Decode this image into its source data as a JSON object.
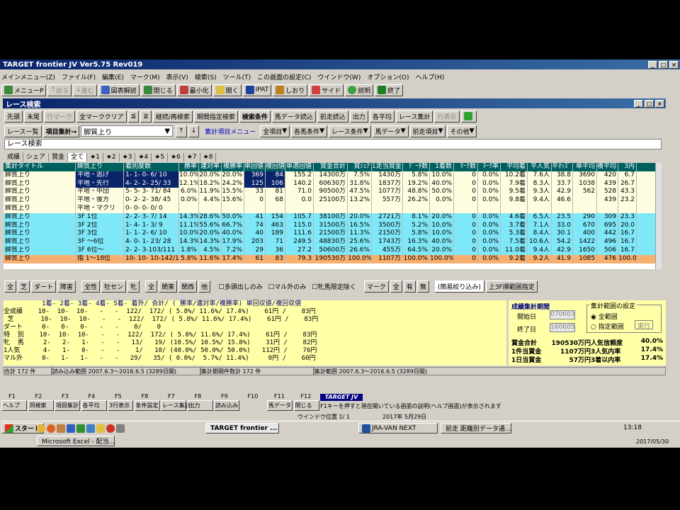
{
  "app": {
    "title": "TARGET frontier JV  Ver5.75  Rev019"
  },
  "menu": [
    "メインメニュー(Z)",
    "ファイル(F)",
    "編集(E)",
    "マーク(M)",
    "表示(V)",
    "検索(S)",
    "ツール(T)",
    "この画面の設定(C)",
    "ウインドウ(W)",
    "オプション(O)",
    "ヘルプ(H)"
  ],
  "toolbar": [
    "メニューP",
    "戻る",
    "進む",
    "図表解説",
    "閉じる",
    "最小化",
    "開く",
    "IPAT",
    "しおり",
    "サイド",
    "説明",
    "終了"
  ],
  "subwindow": {
    "title": "レース検索"
  },
  "buttons1": [
    "先頭",
    "末尾",
    "行マーク",
    "全マーククリア",
    "≦",
    "≧",
    "継続/再検索",
    "期間指定検索",
    "検索条件",
    "馬データ読込",
    "前走読込",
    "出力",
    "各平均",
    "レース集計",
    "行表示"
  ],
  "selector": {
    "label1": "レース一覧",
    "label2": "項目集計→",
    "value": "脚質上り",
    "menu": "集計項目メニュー",
    "dropdowns": [
      "全項目",
      "各馬条件",
      "レース条件",
      "馬データ",
      "前走項目",
      "その他"
    ]
  },
  "search_label": "レース検索",
  "tabs": [
    "成績",
    "シェア",
    "賞金",
    "全て",
    "★1",
    "★2",
    "★3",
    "★4",
    "★5",
    "★6",
    "★7",
    "★8"
  ],
  "grid": {
    "headers": [
      "集計タイトル",
      "脚質上り",
      "着別度数",
      "勝率",
      "連対率",
      "複勝率",
      "単回値",
      "複回値",
      "単適回値",
      "賞金合計",
      "賞ｼｪｱ",
      "1走当賞金",
      "ﾃﾞｰﾀ数",
      "1着数",
      "ﾏｰｸ数",
      "ﾏｰｸ率",
      "平均着",
      "平人気",
      "平ｵｯｽﾞ",
      "単平均",
      "複平均",
      "3内"
    ],
    "rows": [
      [
        "脚質上り",
        "平地・逃げ",
        "1- 1- 0- 6/ 10",
        "10.0%",
        "20.0%",
        "20.0%",
        "369",
        "84",
        "155.2",
        "14300万",
        "7.5%",
        "1430万",
        "5.8%",
        "10.0%",
        "0",
        "0.0%",
        "10.2着",
        "7.6人",
        "38.8",
        "3690",
        "420",
        "6.7"
      ],
      [
        "脚質上り",
        "平地・先行",
        "4- 2- 2- 25/ 33",
        "12.1%",
        "18.2%",
        "24.2%",
        "125",
        "106",
        "140.2",
        "60630万",
        "31.8%",
        "1837万",
        "19.2%",
        "40.0%",
        "0",
        "0.0%",
        "7.9着",
        "8.3人",
        "33.7",
        "1038",
        "439",
        "26.7"
      ],
      [
        "脚質上り",
        "平地・中団",
        "5- 5- 3- 71/ 84",
        "6.0%",
        "11.9%",
        "15.5%",
        "33",
        "81",
        "71.0",
        "90500万",
        "47.5%",
        "1077万",
        "48.8%",
        "50.0%",
        "0",
        "0.0%",
        "9.5着",
        "9.3人",
        "42.9",
        "562",
        "528",
        "43.3"
      ],
      [
        "脚質上り",
        "平地・後方",
        "0- 2- 2- 38/ 45",
        "0.0%",
        "4.4%",
        "15.6%",
        "0",
        "68",
        "0.0",
        "25100万",
        "13.2%",
        "557万",
        "26.2%",
        "0.0%",
        "0",
        "0.0%",
        "9.8着",
        "9.4人",
        "46.6",
        "",
        "439",
        "23.2"
      ],
      [
        "脚質上り",
        "平地・マクリ",
        "0- 0- 0- 0/ 0",
        "",
        "",
        "",
        "",
        "",
        "",
        "",
        "",
        "",
        "",
        "",
        "",
        "",
        "",
        "",
        "",
        "",
        "",
        ""
      ],
      [
        "脚質上り",
        "3F  1位",
        "2- 2- 3- 7/ 14",
        "14.3%",
        "28.6%",
        "50.0%",
        "41",
        "154",
        "105.7",
        "38100万",
        "20.0%",
        "2721万",
        "8.1%",
        "20.0%",
        "0",
        "0.0%",
        "4.6着",
        "6.5人",
        "23.5",
        "290",
        "309",
        "23.3"
      ],
      [
        "脚質上り",
        "3F  2位",
        "1- 4- 1- 3/ 9",
        "11.1%",
        "55.6%",
        "66.7%",
        "74",
        "463",
        "115.0",
        "31500万",
        "16.5%",
        "3500万",
        "5.2%",
        "10.0%",
        "0",
        "0.0%",
        "3.7着",
        "7.1人",
        "33.0",
        "670",
        "695",
        "20.0"
      ],
      [
        "脚質上り",
        "3F  3位",
        "1- 1- 2- 6/ 10",
        "10.0%",
        "20.0%",
        "40.0%",
        "40",
        "189",
        "111.6",
        "21500万",
        "11.3%",
        "2150万",
        "5.8%",
        "10.0%",
        "0",
        "0.0%",
        "5.3着",
        "8.4人",
        "30.1",
        "400",
        "442",
        "16.7"
      ],
      [
        "脚質上り",
        "3F ～6位",
        "4- 0- 1- 23/ 28",
        "14.3%",
        "14.3%",
        "17.9%",
        "203",
        "71",
        "249.5",
        "48830万",
        "25.6%",
        "1743万",
        "16.3%",
        "40.0%",
        "0",
        "0.0%",
        "7.5着",
        "10.6人",
        "54.2",
        "1422",
        "496",
        "16.7"
      ],
      [
        "脚質上り",
        "3F  6位～",
        "2- 2- 3-103/111",
        "1.8%",
        "4.5%",
        "7.2%",
        "29",
        "36",
        "27.2",
        "50600万",
        "26.6%",
        "455万",
        "64.5%",
        "20.0%",
        "0",
        "0.0%",
        "11.0着",
        "9.4人",
        "42.9",
        "1650",
        "506",
        "16.7"
      ],
      [
        "脚質上り",
        "指 1～18位",
        "10- 10- 10-142/172",
        "5.8%",
        "11.6%",
        "17.4%",
        "61",
        "83",
        "79.3",
        "190530万",
        "100.0%",
        "1107万",
        "100.0%",
        "100.0%",
        "0",
        "0.0%",
        "9.2着",
        "9.2人",
        "41.9",
        "1085",
        "476",
        "100.0"
      ]
    ]
  },
  "filterbar": [
    "全",
    "芝",
    "ダート",
    "障害",
    "全性",
    "牡セン",
    "牝",
    "全",
    "関東",
    "関西",
    "他",
    "多頭出しのみ",
    "マル外のみ",
    "牝馬限定除く",
    "マーク",
    "全",
    "有",
    "無",
    "(簡易絞り込み)",
    "上3F順範囲指定"
  ],
  "summary": {
    "header": "          1着- 2着- 3着- 4着- 5着- 着外/ 合計/ ( 勝率/連対率/複勝率) 単回収値/複回収値",
    "lines": [
      "全成績    10-  10-  10-   -   -  122/  172/ ( 5.8%/ 11.6%/ 17.4%)    61円 /    83円",
      " 芝       10-  10-  10-   -   -  122/  172/ ( 5.8%/ 11.6%/ 17.4%)    61円 /    83円",
      "ダート     0-   0-   0-   -   -    0/    0",
      "特  別    10-  10-  10-   -   -  122/  172/ ( 5.8%/ 11.6%/ 17.4%)    61円 /    83円",
      "牝  馬     2-   2-   1-   -   -   13/   19/ (10.5%/ 10.5%/ 15.8%)    31円 /    82円",
      "1人気      4-   1-   0-   -   -    1/   10/ (40.0%/ 50.0%/ 50.0%)   112円 /    76円",
      "マル外     0-   1-   1-   -   -   29/   35/ ( 0.0%/  5.7%/ 11.4%)     0円 /    60円"
    ],
    "footer1": "合計 172 件",
    "footer2": "読み込み範囲 2007.6.3～2016.6.5 (3289日間)",
    "footer3": "集計期間件数計 172 件",
    "footer4": "集計範囲 2007.6.3～2016.6.5 (3289日間)"
  },
  "rightpanel": {
    "title": "成績集計期間",
    "start_label": "開始日",
    "start": "070603",
    "end_label": "終了日",
    "end": "160605",
    "range_title": "集計範囲の設定",
    "opt1": "全範囲",
    "opt2": "指定範囲",
    "exec": "実行",
    "stats": [
      [
        "賞金合計",
        "190530万円",
        "人気信頼度",
        "40.0%"
      ],
      [
        "1件当賞金",
        "1107万円",
        "3人気内率",
        "17.4%"
      ],
      [
        "1日当賞金",
        "57万円",
        "3着以内率",
        "17.4%"
      ]
    ]
  },
  "fkeys": {
    "labels": [
      "F1",
      "F2",
      "F3",
      "F4",
      "F5",
      "F8",
      "F7",
      "F8",
      "F9",
      "F10",
      "F11",
      "F12"
    ],
    "names": [
      "ヘルプ",
      "同検索",
      "項目集計",
      "各平均",
      "3行表示",
      "条件設定",
      "レース集計",
      "出力",
      "読み込み",
      "",
      "馬データ",
      "閉じる"
    ],
    "brand": "TARGET JV",
    "hint": "F1キーを押すと現在開いている画面の説明(ヘルプ画面)が表示されます",
    "pos": "ウインドウ位置 1/ 1",
    "date": "2017年 5月29日"
  },
  "taskbar": {
    "start": "スタート",
    "items": [
      "TARGET frontier ...",
      "JRA-VAN NEXT",
      "前走 距離別データ通...",
      "Microsoft Excel - 配当..."
    ],
    "clock": "13:18",
    "date": "2017/05/30"
  }
}
